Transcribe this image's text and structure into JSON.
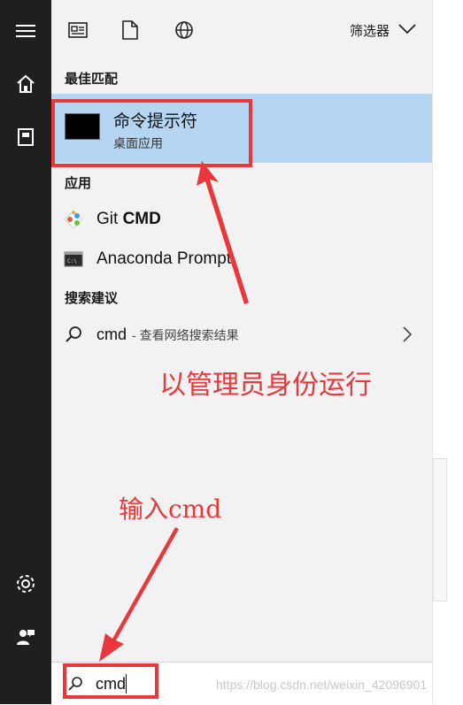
{
  "toolbar": {
    "filter_label": "筛选器",
    "icons": [
      "news-icon",
      "document-icon",
      "globe-icon",
      "chevron-down-icon"
    ]
  },
  "rail": {
    "icons": [
      "hamburger-icon",
      "home-icon",
      "notebook-icon",
      "gear-icon",
      "feedback-icon"
    ]
  },
  "sections": {
    "best_match": "最佳匹配",
    "apps": "应用",
    "search_suggestions": "搜索建议"
  },
  "best_match": {
    "title": "命令提示符",
    "subtitle": "桌面应用"
  },
  "apps": [
    {
      "name_prefix": "Git ",
      "name_bold": "CMD",
      "icon": "git-icon"
    },
    {
      "name_prefix": "Anaconda Prompt",
      "name_bold": "",
      "icon": "terminal-icon"
    }
  ],
  "suggestion": {
    "term": "cmd",
    "detail": "- 查看网络搜索结果"
  },
  "search": {
    "value": "cmd"
  },
  "annotations": {
    "run_as_admin": "以管理员身份运行",
    "type_cmd": "输入cmd"
  },
  "watermark": "https://blog.csdn.net/weixin_42096901",
  "colors": {
    "highlight": "#b5d6f2",
    "annotation_red": "#e8383b",
    "rail": "#1f1f1f",
    "panel": "#f2f2f2"
  }
}
